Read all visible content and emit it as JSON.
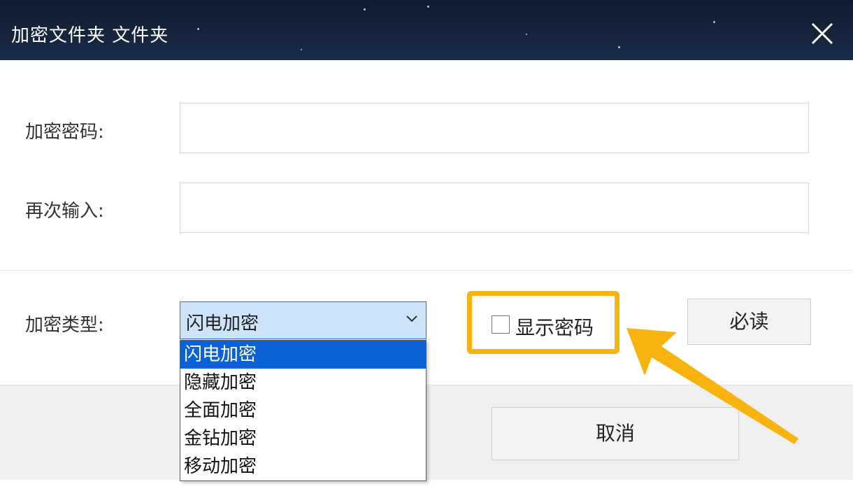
{
  "window": {
    "title": "加密文件夹 文件夹",
    "close_icon": "close-icon"
  },
  "form": {
    "password_label": "加密密码:",
    "password_value": "",
    "confirm_label": "再次输入:",
    "confirm_value": "",
    "type_label": "加密类型:",
    "type_selected": "闪电加密",
    "type_options": [
      "闪电加密",
      "隐藏加密",
      "全面加密",
      "金钻加密",
      "移动加密"
    ],
    "show_password_label": "显示密码",
    "show_password_checked": false,
    "must_read_label": "必读"
  },
  "footer": {
    "cancel_label": "取消"
  },
  "colors": {
    "highlight": "#f7b30e",
    "selection": "#0b62d6",
    "select_bg": "#cde3f7"
  }
}
